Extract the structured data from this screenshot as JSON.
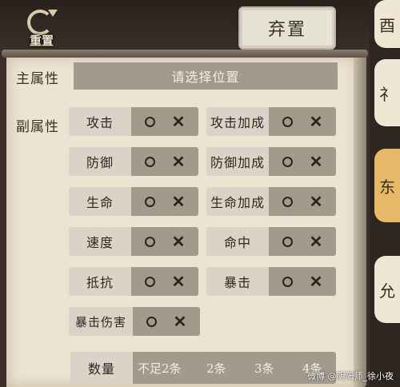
{
  "topbar": {
    "reset_label": "重置",
    "discard_label": "弃置"
  },
  "side_tabs": [
    "酉",
    "礻",
    "东",
    "允"
  ],
  "main_attr": {
    "label": "主属性",
    "placeholder": "请选择位置"
  },
  "sub_attr": {
    "label": "副属性",
    "items": [
      {
        "name": "攻击"
      },
      {
        "name": "攻击加成"
      },
      {
        "name": "防御"
      },
      {
        "name": "防御加成"
      },
      {
        "name": "生命"
      },
      {
        "name": "生命加成"
      },
      {
        "name": "速度"
      },
      {
        "name": "命中"
      },
      {
        "name": "抵抗"
      },
      {
        "name": "暴击"
      },
      {
        "name": "暴击伤害"
      }
    ]
  },
  "count": {
    "label": "数量",
    "options": [
      "不足2条",
      "2条",
      "3条",
      "4条"
    ]
  },
  "watermark": "微博 @阴阳师_徐小夜"
}
